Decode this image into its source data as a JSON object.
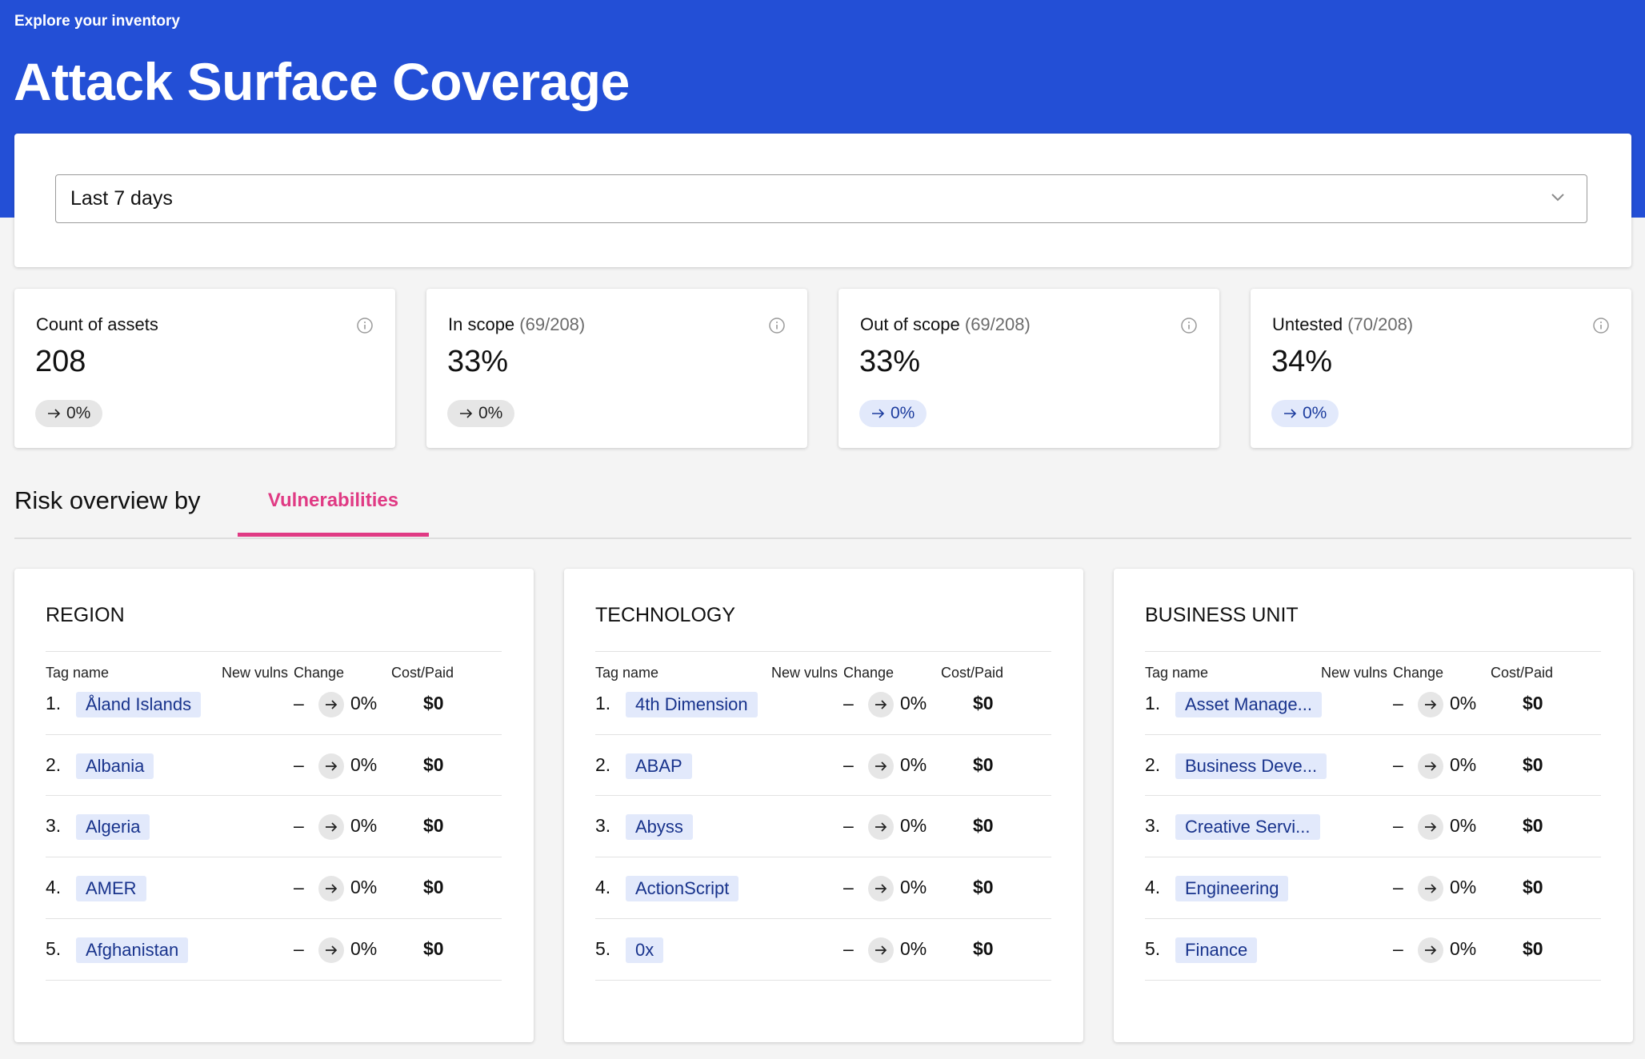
{
  "header": {
    "subtitle": "Explore your inventory",
    "title": "Attack Surface Coverage"
  },
  "filter": {
    "selected": "Last 7 days"
  },
  "stats": [
    {
      "label": "Count of assets",
      "fraction": "",
      "value": "208",
      "delta": "0%",
      "delta_style": "neutral"
    },
    {
      "label": "In scope",
      "fraction": "(69/208)",
      "value": "33%",
      "delta": "0%",
      "delta_style": "neutral"
    },
    {
      "label": "Out of scope",
      "fraction": "(69/208)",
      "value": "33%",
      "delta": "0%",
      "delta_style": "blue"
    },
    {
      "label": "Untested",
      "fraction": "(70/208)",
      "value": "34%",
      "delta": "0%",
      "delta_style": "blue"
    }
  ],
  "risk": {
    "label": "Risk overview by",
    "active_tab": "Vulnerabilities"
  },
  "columns": {
    "tag_name": "Tag name",
    "new_vulns": "New vulns",
    "change": "Change",
    "cost_paid": "Cost/Paid"
  },
  "panels": [
    {
      "title": "REGION",
      "rows": [
        {
          "rank": "1.",
          "tag": "Åland Islands",
          "new_vulns": "–",
          "change": "0%",
          "cost": "$0"
        },
        {
          "rank": "2.",
          "tag": "Albania",
          "new_vulns": "–",
          "change": "0%",
          "cost": "$0"
        },
        {
          "rank": "3.",
          "tag": "Algeria",
          "new_vulns": "–",
          "change": "0%",
          "cost": "$0"
        },
        {
          "rank": "4.",
          "tag": "AMER",
          "new_vulns": "–",
          "change": "0%",
          "cost": "$0"
        },
        {
          "rank": "5.",
          "tag": "Afghanistan",
          "new_vulns": "–",
          "change": "0%",
          "cost": "$0"
        }
      ]
    },
    {
      "title": "TECHNOLOGY",
      "rows": [
        {
          "rank": "1.",
          "tag": "4th Dimension",
          "new_vulns": "–",
          "change": "0%",
          "cost": "$0"
        },
        {
          "rank": "2.",
          "tag": "ABAP",
          "new_vulns": "–",
          "change": "0%",
          "cost": "$0"
        },
        {
          "rank": "3.",
          "tag": "Abyss",
          "new_vulns": "–",
          "change": "0%",
          "cost": "$0"
        },
        {
          "rank": "4.",
          "tag": "ActionScript",
          "new_vulns": "–",
          "change": "0%",
          "cost": "$0"
        },
        {
          "rank": "5.",
          "tag": "0x",
          "new_vulns": "–",
          "change": "0%",
          "cost": "$0"
        }
      ]
    },
    {
      "title": "BUSINESS UNIT",
      "rows": [
        {
          "rank": "1.",
          "tag": "Asset Manage...",
          "new_vulns": "–",
          "change": "0%",
          "cost": "$0"
        },
        {
          "rank": "2.",
          "tag": "Business Deve...",
          "new_vulns": "–",
          "change": "0%",
          "cost": "$0"
        },
        {
          "rank": "3.",
          "tag": "Creative Servi...",
          "new_vulns": "–",
          "change": "0%",
          "cost": "$0"
        },
        {
          "rank": "4.",
          "tag": "Engineering",
          "new_vulns": "–",
          "change": "0%",
          "cost": "$0"
        },
        {
          "rank": "5.",
          "tag": "Finance",
          "new_vulns": "–",
          "change": "0%",
          "cost": "$0"
        }
      ]
    }
  ]
}
